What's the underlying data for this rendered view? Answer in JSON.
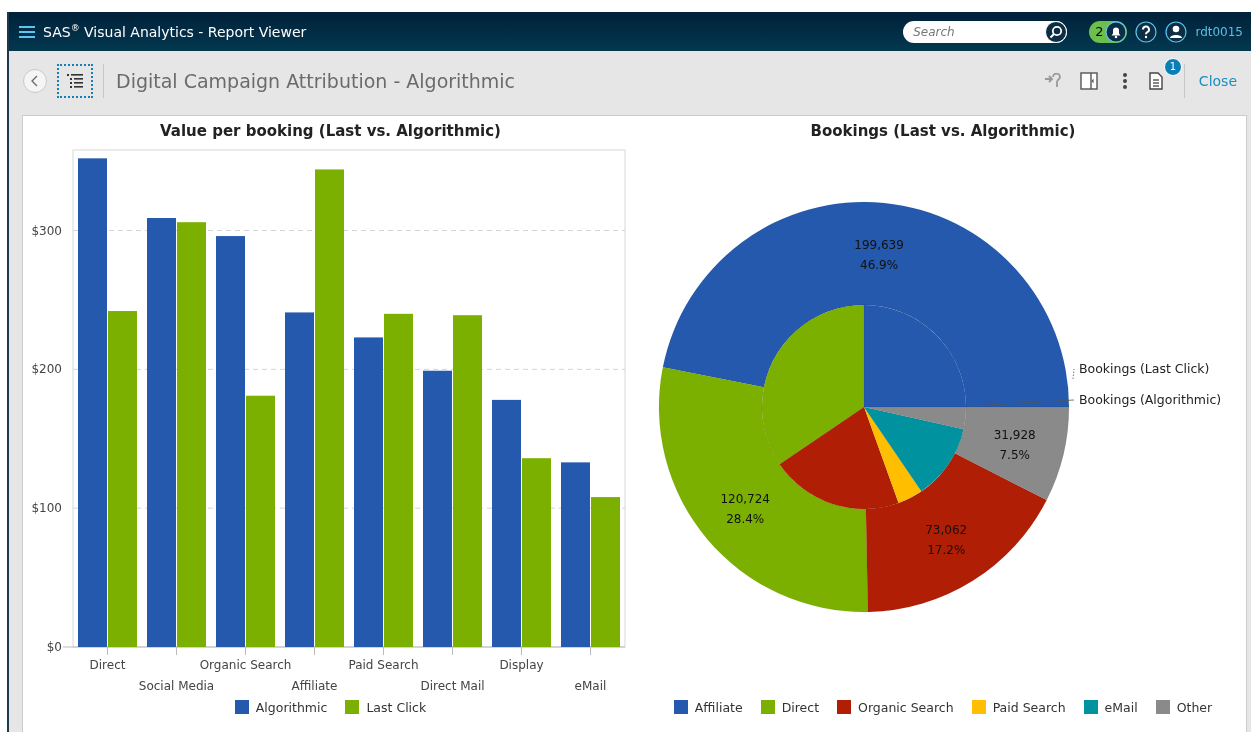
{
  "header": {
    "title": "SAS$^{®}$ Visual Analytics - Report Viewer",
    "search": {
      "placeholder": "Search"
    },
    "notification_count": "2",
    "user": "rdt0015"
  },
  "toolbar": {
    "report_title": "Digital Campaign Attribution - Algorithmic",
    "comments_badge": "1",
    "close": "Close"
  },
  "left_chart": {
    "chart_data": {
      "type": "bar",
      "title": "Value per booking (Last vs. Algorithmic)",
      "categories": [
        "Direct",
        "Social Media",
        "Organic Search",
        "Affiliate",
        "Paid Search",
        "Direct Mail",
        "Display",
        "eMail"
      ],
      "series": [
        {
          "name": "Algorithmic",
          "color": "#2459ad",
          "values": [
            352,
            309,
            296,
            241,
            223,
            199,
            178,
            133
          ]
        },
        {
          "name": "Last Click",
          "color": "#7cb000",
          "values": [
            242,
            306,
            181,
            344,
            240,
            239,
            136,
            108
          ]
        }
      ],
      "grid": true,
      "legend": "bottom",
      "ylim": [
        0,
        358
      ],
      "yticks": [
        {
          "value": 0,
          "label": "$0"
        },
        {
          "value": 100,
          "label": "$100"
        },
        {
          "value": 200,
          "label": "$200"
        },
        {
          "value": 300,
          "label": "$300"
        }
      ]
    }
  },
  "right_chart": {
    "chart_data": {
      "type": "donut",
      "title": "Bookings (Last vs. Algorithmic)",
      "categories": [
        "Affiliate",
        "Direct",
        "Organic Search",
        "Paid Search",
        "eMail",
        "Other"
      ],
      "legend": "bottom",
      "colors": [
        "#2459ad",
        "#7cb000",
        "#b01e06",
        "#ffbf00",
        "#00929f",
        "#8a8a8a"
      ],
      "series": [
        {
          "name": "Bookings (Last Click)",
          "values": [
            46.9,
            28.4,
            17.2,
            null,
            null,
            7.5
          ]
        },
        {
          "name": "Bookings (Algorithmic)",
          "values": [
            25,
            34.5,
            21,
            4,
            12,
            3.5
          ]
        }
      ],
      "value_labels": [
        [
          "199,639",
          "46.9%"
        ],
        [
          "120,724",
          "28.4%"
        ],
        [
          "73,062",
          "17.2%"
        ],
        null,
        null,
        [
          "31,928",
          "7.5%"
        ]
      ]
    }
  }
}
